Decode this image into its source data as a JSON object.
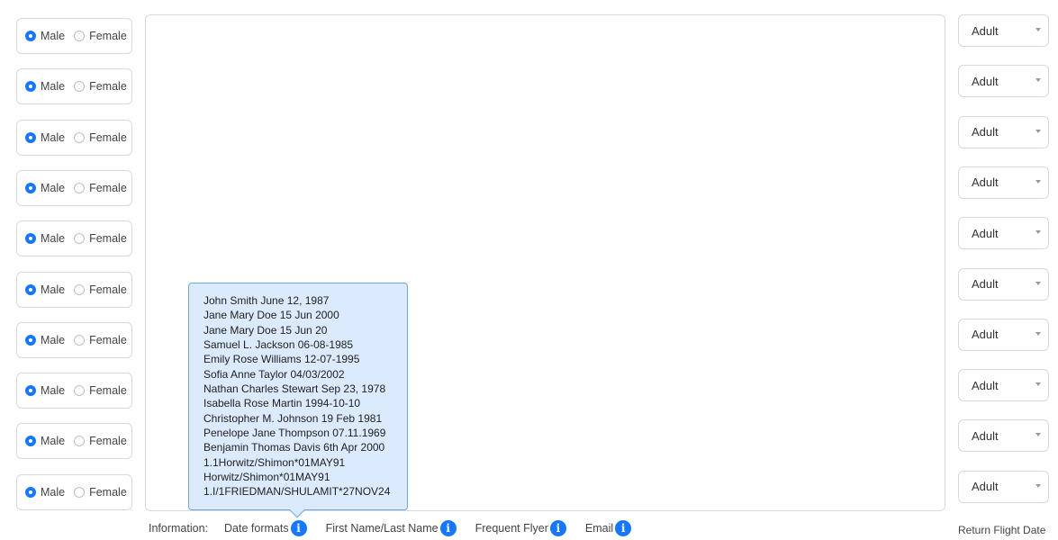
{
  "passengers": [
    {
      "gender_options": [
        "Male",
        "Female"
      ],
      "selected": "Male",
      "type": "Adult"
    },
    {
      "gender_options": [
        "Male",
        "Female"
      ],
      "selected": "Male",
      "type": "Adult"
    },
    {
      "gender_options": [
        "Male",
        "Female"
      ],
      "selected": "Male",
      "type": "Adult"
    },
    {
      "gender_options": [
        "Male",
        "Female"
      ],
      "selected": "Male",
      "type": "Adult"
    },
    {
      "gender_options": [
        "Male",
        "Female"
      ],
      "selected": "Male",
      "type": "Adult"
    },
    {
      "gender_options": [
        "Male",
        "Female"
      ],
      "selected": "Male",
      "type": "Adult"
    },
    {
      "gender_options": [
        "Male",
        "Female"
      ],
      "selected": "Male",
      "type": "Adult"
    },
    {
      "gender_options": [
        "Male",
        "Female"
      ],
      "selected": "Male",
      "type": "Adult"
    },
    {
      "gender_options": [
        "Male",
        "Female"
      ],
      "selected": "Male",
      "type": "Adult"
    },
    {
      "gender_options": [
        "Male",
        "Female"
      ],
      "selected": "Male",
      "type": "Adult"
    }
  ],
  "tooltip": {
    "lines": [
      "John Smith June 12, 1987",
      "Jane Mary Doe 15 Jun 2000",
      "Jane Mary Doe 15 Jun 20",
      "Samuel L. Jackson 06-08-1985",
      "Emily Rose Williams 12-07-1995",
      "Sofia Anne Taylor 04/03/2002",
      "Nathan Charles Stewart Sep 23, 1978",
      "Isabella Rose Martin 1994-10-10",
      "Christopher M. Johnson 19 Feb 1981",
      "Penelope Jane Thompson 07.11.1969",
      "Benjamin Thomas Davis 6th Apr 2000",
      "1.1Horwitz/Shimon*01MAY91",
      "Horwitz/Shimon*01MAY91",
      "1.I/1FRIEDMAN/SHULAMIT*27NOV24"
    ]
  },
  "info_bar": {
    "label": "Information:",
    "items": [
      "Date formats",
      "First Name/Last Name",
      "Frequent Flyer",
      "Email"
    ]
  },
  "return_flight_label": "Return Flight Date",
  "icons": {
    "info": "info-icon",
    "radio": "radio-icon",
    "dropdown": "chevron-down-icon"
  },
  "colors": {
    "accent": "#1677ff",
    "tooltip_bg": "#dbeafd",
    "tooltip_border": "#6ea8e8"
  }
}
